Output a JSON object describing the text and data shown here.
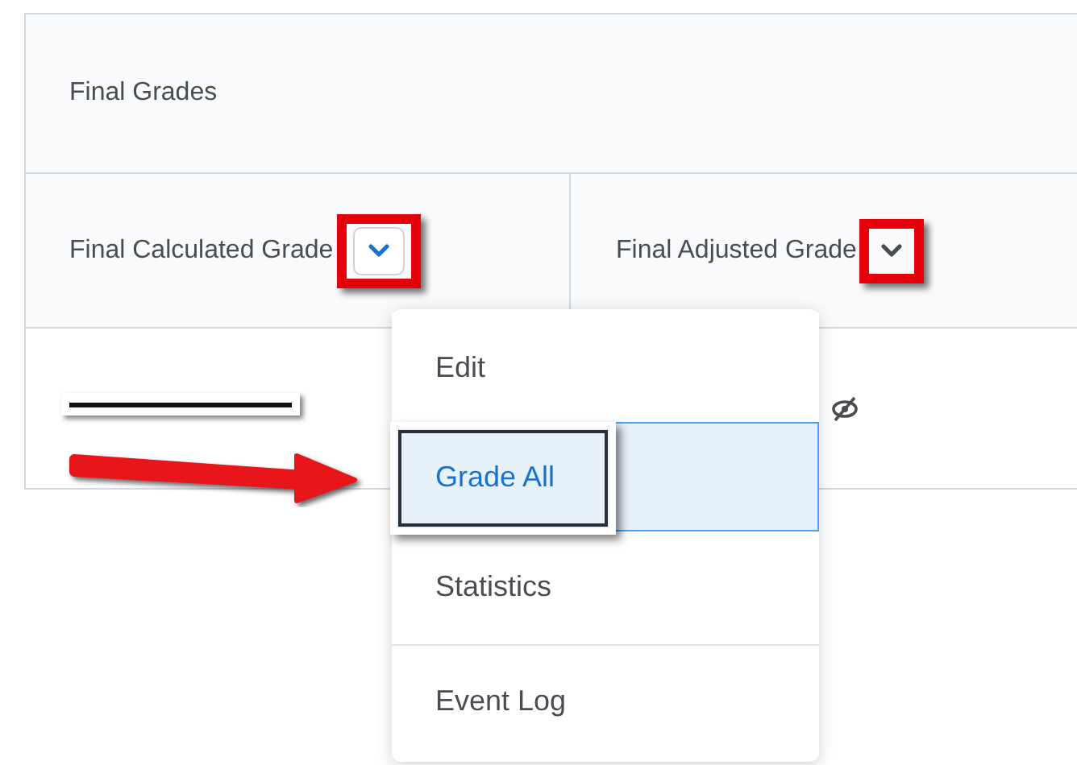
{
  "table": {
    "group_header": "Final Grades",
    "columns": [
      {
        "label": "Final Calculated Grade",
        "menu_open": true
      },
      {
        "label": "Final Adjusted Grade",
        "menu_open": false
      }
    ],
    "row": {
      "hidden": true
    }
  },
  "menu": {
    "items": [
      {
        "label": "Edit",
        "selected": false
      },
      {
        "label": "Grade All",
        "selected": true
      },
      {
        "label": "Statistics",
        "selected": false
      },
      {
        "label": "Event Log",
        "selected": false
      }
    ]
  }
}
